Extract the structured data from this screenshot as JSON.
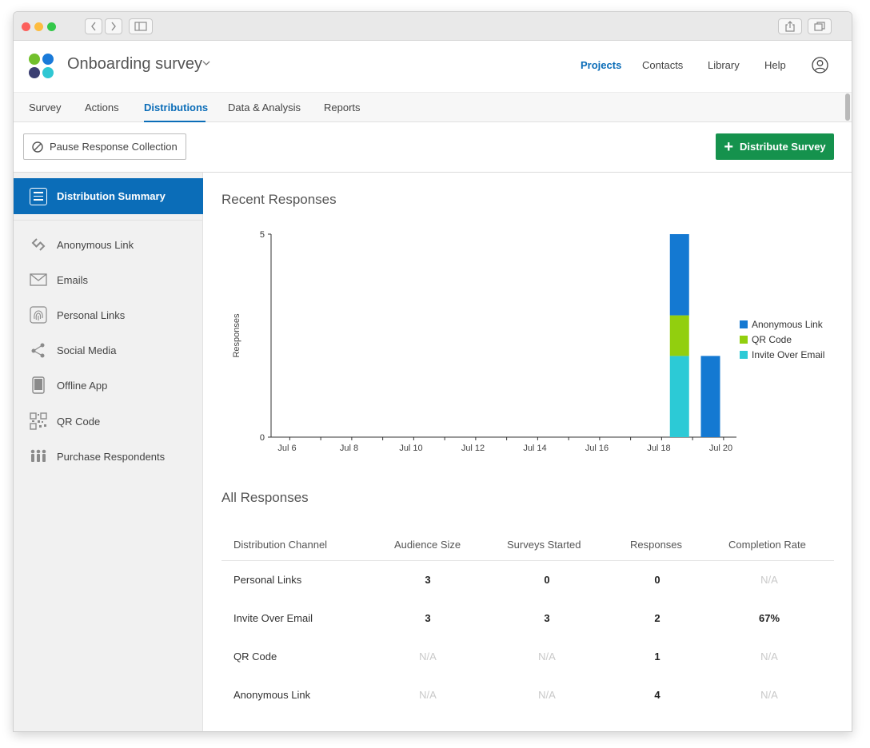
{
  "header": {
    "survey_title": "Onboarding survey",
    "nav": [
      "Projects",
      "Contacts",
      "Library",
      "Help"
    ],
    "active_nav": "Projects"
  },
  "tabs": [
    "Survey",
    "Actions",
    "Distributions",
    "Data & Analysis",
    "Reports"
  ],
  "active_tab": "Distributions",
  "actions": {
    "pause_label": "Pause Response Collection",
    "distribute_label": "Distribute Survey"
  },
  "sidebar": {
    "active": "Distribution Summary",
    "items": [
      {
        "label": "Anonymous Link",
        "icon": "link-icon"
      },
      {
        "label": "Emails",
        "icon": "envelope-icon"
      },
      {
        "label": "Personal Links",
        "icon": "fingerprint-icon"
      },
      {
        "label": "Social Media",
        "icon": "share-icon"
      },
      {
        "label": "Offline App",
        "icon": "tablet-icon"
      },
      {
        "label": "QR Code",
        "icon": "qr-code-icon"
      },
      {
        "label": "Purchase Respondents",
        "icon": "people-icon"
      }
    ]
  },
  "recent_title": "Recent Responses",
  "all_title": "All Responses",
  "colors": {
    "anonymous_link": "#1479d2",
    "qr_code": "#92cf0e",
    "invite_over_email": "#2ccad6",
    "brand_blue": "#0b6db8",
    "brand_green": "#15924d"
  },
  "chart_data": {
    "type": "bar",
    "stacked": true,
    "title": "",
    "ylabel": "Responses",
    "xlabel": "",
    "ylim": [
      0,
      5
    ],
    "yticks": [
      0,
      5
    ],
    "xticks": [
      "Jul 6",
      "Jul 8",
      "Jul 10",
      "Jul 12",
      "Jul 14",
      "Jul 16",
      "Jul 18",
      "Jul 20"
    ],
    "categories": [
      "Jul 19",
      "Jul 20"
    ],
    "series": [
      {
        "name": "Invite Over Email",
        "values": [
          2,
          0
        ]
      },
      {
        "name": "QR Code",
        "values": [
          1,
          0
        ]
      },
      {
        "name": "Anonymous Link",
        "values": [
          2,
          2
        ]
      }
    ],
    "legend": [
      "Anonymous Link",
      "QR Code",
      "Invite Over Email"
    ],
    "legend_position": "right"
  },
  "table": {
    "columns": [
      "Distribution Channel",
      "Audience Size",
      "Surveys Started",
      "Responses",
      "Completion Rate"
    ],
    "rows": [
      [
        "Personal Links",
        "3",
        "0",
        "0",
        "N/A"
      ],
      [
        "Invite Over Email",
        "3",
        "3",
        "2",
        "67%"
      ],
      [
        "QR Code",
        "N/A",
        "N/A",
        "1",
        "N/A"
      ],
      [
        "Anonymous Link",
        "N/A",
        "N/A",
        "4",
        "N/A"
      ]
    ]
  }
}
